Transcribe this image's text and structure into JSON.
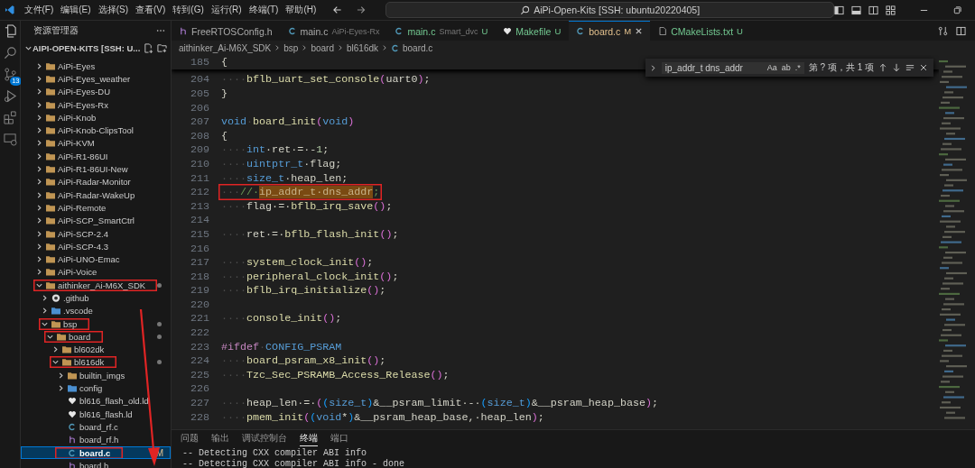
{
  "window": {
    "title": "AiPi-Open-Kits [SSH: ubuntu20220405]"
  },
  "menu": [
    "文件(F)",
    "编辑(E)",
    "选择(S)",
    "查看(V)",
    "转到(G)",
    "运行(R)",
    "终端(T)",
    "帮助(H)"
  ],
  "activity_bar": {
    "source_control_badge": "13"
  },
  "sidebar": {
    "title": "资源管理器",
    "root": "AIPI-OPEN-KITS [SSH: U...",
    "tree": [
      {
        "label": "AiPi-Eyes",
        "kind": "folder",
        "expanded": false,
        "selected": false,
        "annotated": false,
        "dot": false
      },
      {
        "label": "AiPi-Eyes_weather",
        "kind": "folder",
        "expanded": false,
        "selected": false,
        "annotated": false,
        "dot": false
      },
      {
        "label": "AiPi-Eyes-DU",
        "kind": "folder",
        "expanded": false,
        "selected": false,
        "annotated": false,
        "dot": false
      },
      {
        "label": "AiPi-Eyes-Rx",
        "kind": "folder",
        "expanded": false,
        "selected": false,
        "annotated": false,
        "dot": false
      },
      {
        "label": "AiPi-Knob",
        "kind": "folder",
        "expanded": false,
        "selected": false,
        "annotated": false,
        "dot": false
      },
      {
        "label": "AiPi-Knob-ClipsTool",
        "kind": "folder",
        "expanded": false,
        "selected": false,
        "annotated": false,
        "dot": false
      },
      {
        "label": "AiPi-KVM",
        "kind": "folder",
        "expanded": false,
        "selected": false,
        "annotated": false,
        "dot": false
      },
      {
        "label": "AiPi-R1-86UI",
        "kind": "folder",
        "expanded": false,
        "selected": false,
        "annotated": false,
        "dot": false
      },
      {
        "label": "AiPi-R1-86UI-New",
        "kind": "folder",
        "expanded": false,
        "selected": false,
        "annotated": false,
        "dot": false
      },
      {
        "label": "AiPi-Radar-Monitor",
        "kind": "folder",
        "expanded": false,
        "selected": false,
        "annotated": false,
        "dot": false
      },
      {
        "label": "AiPi-Radar-WakeUp",
        "kind": "folder",
        "expanded": false,
        "selected": false,
        "annotated": false,
        "dot": false
      },
      {
        "label": "AiPi-Remote",
        "kind": "folder",
        "expanded": false,
        "selected": false,
        "annotated": false,
        "dot": false
      },
      {
        "label": "AiPi-SCP_SmartCtrl",
        "kind": "folder",
        "expanded": false,
        "selected": false,
        "annotated": false,
        "dot": false
      },
      {
        "label": "AiPi-SCP-2.4",
        "kind": "folder",
        "expanded": false,
        "selected": false,
        "annotated": false,
        "dot": false
      },
      {
        "label": "AiPi-SCP-4.3",
        "kind": "folder",
        "expanded": false,
        "selected": false,
        "annotated": false,
        "dot": false
      },
      {
        "label": "AiPi-UNO-Emac",
        "kind": "folder",
        "expanded": false,
        "selected": false,
        "annotated": false,
        "dot": false
      },
      {
        "label": "AiPi-Voice",
        "kind": "folder",
        "expanded": false,
        "selected": false,
        "annotated": false,
        "dot": false
      },
      {
        "label": "aithinker_Ai-M6X_SDK",
        "kind": "folder",
        "expanded": true,
        "selected": false,
        "annotated": true,
        "dot": true,
        "children": [
          {
            "label": ".github",
            "kind": "github",
            "expanded": false,
            "selected": false,
            "annotated": false,
            "dot": false
          },
          {
            "label": ".vscode",
            "kind": "vscode",
            "expanded": false,
            "selected": false,
            "annotated": false,
            "dot": false
          },
          {
            "label": "bsp",
            "kind": "folder",
            "expanded": true,
            "selected": false,
            "annotated": true,
            "dot": true,
            "children": [
              {
                "label": "board",
                "kind": "folder",
                "expanded": true,
                "selected": false,
                "annotated": true,
                "dot": true,
                "children": [
                  {
                    "label": "bl602dk",
                    "kind": "folder",
                    "expanded": false,
                    "selected": false,
                    "annotated": false,
                    "dot": false
                  },
                  {
                    "label": "bl616dk",
                    "kind": "folder",
                    "expanded": true,
                    "selected": false,
                    "annotated": true,
                    "dot": true,
                    "children": [
                      {
                        "label": "builtin_imgs",
                        "kind": "folder",
                        "expanded": false,
                        "selected": false,
                        "annotated": false,
                        "dot": false
                      },
                      {
                        "label": "config",
                        "kind": "config",
                        "expanded": false,
                        "selected": false,
                        "annotated": false,
                        "dot": false
                      },
                      {
                        "label": "bl616_flash_old.ld",
                        "kind": "ld",
                        "selected": false,
                        "annotated": false,
                        "dot": false
                      },
                      {
                        "label": "bl616_flash.ld",
                        "kind": "ld",
                        "selected": false,
                        "annotated": false,
                        "dot": false
                      },
                      {
                        "label": "board_rf.c",
                        "kind": "c",
                        "selected": false,
                        "annotated": false,
                        "dot": false
                      },
                      {
                        "label": "board_rf.h",
                        "kind": "h",
                        "selected": false,
                        "annotated": false,
                        "dot": false
                      },
                      {
                        "label": "board.c",
                        "kind": "c",
                        "selected": true,
                        "annotated": true,
                        "dot": false,
                        "status": "M"
                      },
                      {
                        "label": "board.h",
                        "kind": "h",
                        "selected": false,
                        "annotated": false,
                        "dot": false
                      }
                    ]
                  }
                ]
              }
            ]
          }
        ]
      }
    ]
  },
  "tabs": [
    {
      "label": "FreeRTOSConfig.h",
      "kind": "h",
      "selected": false
    },
    {
      "label": "main.c",
      "description": "AiPi-Eyes-Rx",
      "kind": "c",
      "selected": false
    },
    {
      "label": "main.c",
      "description": "Smart_dvc",
      "status": "U",
      "kind": "c",
      "selected": false
    },
    {
      "label": "Makefile",
      "status": "U",
      "kind": "makefile",
      "selected": false
    },
    {
      "label": "board.c",
      "status": "M",
      "kind": "c",
      "selected": true
    },
    {
      "label": "CMakeLists.txt",
      "status": "U",
      "kind": "cmake",
      "selected": false
    }
  ],
  "breadcrumb": [
    "aithinker_Ai-M6X_SDK",
    "bsp",
    "board",
    "bl616dk",
    "board.c"
  ],
  "find_widget": {
    "value": "ip_addr_t dns_addr",
    "options": [
      "Aa",
      "ab",
      ".*"
    ],
    "result": "第 ? 项，共 1 项"
  },
  "code": {
    "sticky": {
      "number": "185",
      "tokens": [
        {
          "text": "{",
          "kind": "plain"
        }
      ]
    },
    "lines": [
      {
        "number": "204",
        "annotated": false,
        "tokens": [
          {
            "text": "····",
            "kind": "ws"
          },
          {
            "text": "bflb_uart_set_console",
            "kind": "fn"
          },
          {
            "text": "(",
            "kind": "paren"
          },
          {
            "text": "uart0",
            "kind": "plain"
          },
          {
            "text": ")",
            "kind": "paren"
          },
          {
            "text": ";",
            "kind": "plain"
          }
        ]
      },
      {
        "number": "205",
        "annotated": false,
        "tokens": [
          {
            "text": "}",
            "kind": "plain"
          }
        ]
      },
      {
        "number": "206"
      },
      {
        "number": "207",
        "annotated": false,
        "tokens": [
          {
            "text": "void",
            "kind": "kw"
          },
          {
            "text": "·",
            "kind": "ws"
          },
          {
            "text": "board_init",
            "kind": "fn"
          },
          {
            "text": "(",
            "kind": "paren"
          },
          {
            "text": "void",
            "kind": "kw"
          },
          {
            "text": ")",
            "kind": "paren"
          }
        ]
      },
      {
        "number": "208",
        "annotated": false,
        "tokens": [
          {
            "text": "{",
            "kind": "plain"
          }
        ]
      },
      {
        "number": "209",
        "annotated": false,
        "tokens": [
          {
            "text": "····",
            "kind": "ws"
          },
          {
            "text": "int",
            "kind": "kw"
          },
          {
            "text": "·ret·=·-",
            "kind": "plain"
          },
          {
            "text": "1",
            "kind": "num"
          },
          {
            "text": ";",
            "kind": "plain"
          }
        ]
      },
      {
        "number": "210",
        "annotated": false,
        "tokens": [
          {
            "text": "····",
            "kind": "ws"
          },
          {
            "text": "uintptr_t",
            "kind": "kw"
          },
          {
            "text": "·flag;",
            "kind": "plain"
          }
        ]
      },
      {
        "number": "211",
        "annotated": false,
        "tokens": [
          {
            "text": "····",
            "kind": "ws"
          },
          {
            "text": "size_t",
            "kind": "kw"
          },
          {
            "text": "·heap_len;",
            "kind": "plain"
          }
        ]
      },
      {
        "number": "212",
        "annotated": true,
        "tokens": [
          {
            "text": "···",
            "kind": "ws"
          },
          {
            "text": "//·",
            "kind": "comment"
          },
          {
            "text": "ip_addr_t·dns_addr",
            "kind": "match"
          },
          {
            "text": ";",
            "kind": "comment"
          }
        ]
      },
      {
        "number": "213",
        "annotated": false,
        "tokens": [
          {
            "text": "····",
            "kind": "ws"
          },
          {
            "text": "flag·=·",
            "kind": "plain"
          },
          {
            "text": "bflb_irq_save",
            "kind": "fn"
          },
          {
            "text": "()",
            "kind": "paren"
          },
          {
            "text": ";",
            "kind": "plain"
          }
        ]
      },
      {
        "number": "214"
      },
      {
        "number": "215",
        "annotated": false,
        "tokens": [
          {
            "text": "····",
            "kind": "ws"
          },
          {
            "text": "ret·=·",
            "kind": "plain"
          },
          {
            "text": "bflb_flash_init",
            "kind": "fn"
          },
          {
            "text": "()",
            "kind": "paren"
          },
          {
            "text": ";",
            "kind": "plain"
          }
        ]
      },
      {
        "number": "216"
      },
      {
        "number": "217",
        "annotated": false,
        "tokens": [
          {
            "text": "····",
            "kind": "ws"
          },
          {
            "text": "system_clock_init",
            "kind": "fn"
          },
          {
            "text": "()",
            "kind": "paren"
          },
          {
            "text": ";",
            "kind": "plain"
          }
        ]
      },
      {
        "number": "218",
        "annotated": false,
        "tokens": [
          {
            "text": "····",
            "kind": "ws"
          },
          {
            "text": "peripheral_clock_init",
            "kind": "fn"
          },
          {
            "text": "()",
            "kind": "paren"
          },
          {
            "text": ";",
            "kind": "plain"
          }
        ]
      },
      {
        "number": "219",
        "annotated": false,
        "tokens": [
          {
            "text": "····",
            "kind": "ws"
          },
          {
            "text": "bflb_irq_initialize",
            "kind": "fn"
          },
          {
            "text": "()",
            "kind": "paren"
          },
          {
            "text": ";",
            "kind": "plain"
          }
        ]
      },
      {
        "number": "220"
      },
      {
        "number": "221",
        "annotated": false,
        "tokens": [
          {
            "text": "····",
            "kind": "ws"
          },
          {
            "text": "console_init",
            "kind": "fn"
          },
          {
            "text": "()",
            "kind": "paren"
          },
          {
            "text": ";",
            "kind": "plain"
          }
        ]
      },
      {
        "number": "222"
      },
      {
        "number": "223",
        "annotated": false,
        "tokens": [
          {
            "text": "#ifdef",
            "kind": "pre"
          },
          {
            "text": "·",
            "kind": "ws"
          },
          {
            "text": "CONFIG_PSRAM",
            "kind": "kw"
          }
        ]
      },
      {
        "number": "224",
        "annotated": false,
        "tokens": [
          {
            "text": "····",
            "kind": "ws"
          },
          {
            "text": "board_psram_x8_init",
            "kind": "fn"
          },
          {
            "text": "()",
            "kind": "paren"
          },
          {
            "text": ";",
            "kind": "plain"
          }
        ]
      },
      {
        "number": "225",
        "annotated": false,
        "tokens": [
          {
            "text": "····",
            "kind": "ws"
          },
          {
            "text": "Tzc_Sec_PSRAMB_Access_Release",
            "kind": "fn"
          },
          {
            "text": "()",
            "kind": "paren"
          },
          {
            "text": ";",
            "kind": "plain"
          }
        ]
      },
      {
        "number": "226"
      },
      {
        "number": "227",
        "annotated": false,
        "tokens": [
          {
            "text": "····",
            "kind": "ws"
          },
          {
            "text": "heap_len·=·",
            "kind": "plain"
          },
          {
            "text": "(",
            "kind": "paren"
          },
          {
            "text": "(",
            "kind": "paren2"
          },
          {
            "text": "size_t",
            "kind": "kw"
          },
          {
            "text": ")",
            "kind": "paren2"
          },
          {
            "text": "&__psram_limit·-·",
            "kind": "plain"
          },
          {
            "text": "(",
            "kind": "paren2"
          },
          {
            "text": "size_t",
            "kind": "kw"
          },
          {
            "text": ")",
            "kind": "paren2"
          },
          {
            "text": "&__psram_heap_base",
            "kind": "plain"
          },
          {
            "text": ")",
            "kind": "paren"
          },
          {
            "text": ";",
            "kind": "plain"
          }
        ]
      },
      {
        "number": "228",
        "annotated": false,
        "tokens": [
          {
            "text": "····",
            "kind": "ws"
          },
          {
            "text": "pmem_init",
            "kind": "fn"
          },
          {
            "text": "(",
            "kind": "paren"
          },
          {
            "text": "(",
            "kind": "paren2"
          },
          {
            "text": "void",
            "kind": "kw"
          },
          {
            "text": "*",
            "kind": "plain"
          },
          {
            "text": ")",
            "kind": "paren2"
          },
          {
            "text": "&__psram_heap_base,·heap_len",
            "kind": "plain"
          },
          {
            "text": ")",
            "kind": "paren"
          },
          {
            "text": ";",
            "kind": "plain"
          }
        ]
      }
    ]
  },
  "panel": {
    "tabs": [
      {
        "label": "问题",
        "selected": false
      },
      {
        "label": "输出",
        "selected": false
      },
      {
        "label": "调试控制台",
        "selected": false
      },
      {
        "label": "终端",
        "selected": true
      },
      {
        "label": "端口",
        "selected": false
      }
    ],
    "lines": [
      "-- Detecting CXX compiler ABI info",
      "-- Detecting CXX compiler ABI info - done"
    ]
  }
}
